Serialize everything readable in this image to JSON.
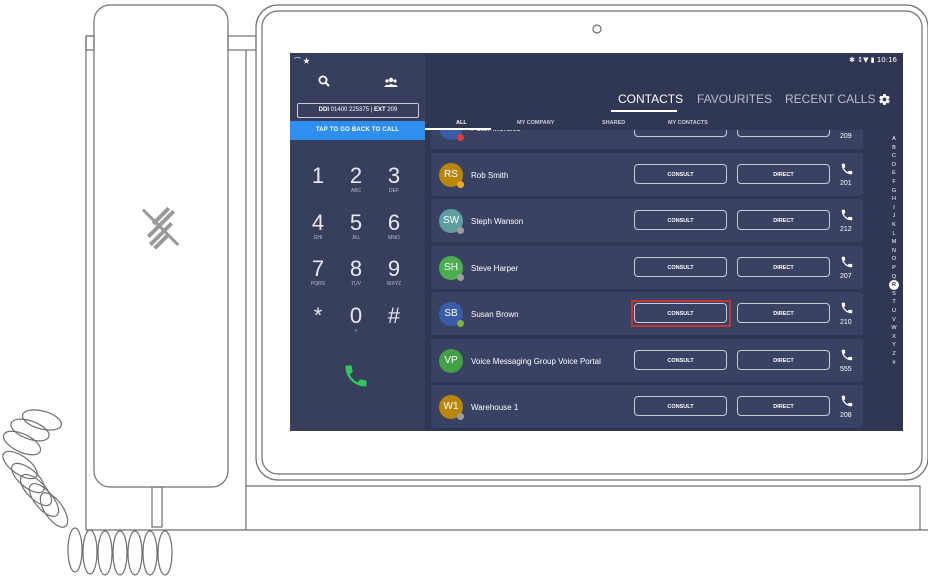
{
  "status_bar": {
    "left_icons": "⌒ ★",
    "right": "✱ ↕▼ ▮ 10:16"
  },
  "left_panel": {
    "search_icon": "search-icon",
    "contacts_icon": "people-icon",
    "ddi_label": "DDI",
    "ddi_number": "01400 225375",
    "separator": "|",
    "ext_label": "EXT",
    "ext_number": "209",
    "tap_back": "TAP TO GO BACK TO CALL",
    "keypad": [
      {
        "digit": "1",
        "letters": ""
      },
      {
        "digit": "2",
        "letters": "ABC"
      },
      {
        "digit": "3",
        "letters": "DEF"
      },
      {
        "digit": "4",
        "letters": "GHI"
      },
      {
        "digit": "5",
        "letters": "JKL"
      },
      {
        "digit": "6",
        "letters": "MNO"
      },
      {
        "digit": "7",
        "letters": "PQRS"
      },
      {
        "digit": "8",
        "letters": "TUV"
      },
      {
        "digit": "9",
        "letters": "WXYZ"
      },
      {
        "digit": "*",
        "letters": ""
      },
      {
        "digit": "0",
        "letters": "+"
      },
      {
        "digit": "#",
        "letters": ""
      }
    ],
    "call_icon": "phone-icon",
    "call_color": "#2dc95b"
  },
  "tabs": [
    "CONTACTS",
    "FAVOURITES",
    "RECENT CALLS"
  ],
  "active_tab": "CONTACTS",
  "settings_icon": "gear-icon",
  "sub_tabs": [
    "ALL",
    "MY COMPANY",
    "SHARED",
    "MY CONTACTS"
  ],
  "active_sub_tab": "ALL",
  "contacts": [
    {
      "initials": "PM",
      "name": "Peter Morales",
      "ext": "209",
      "avatar_color": "#3a5ba8",
      "status_color": "#e53935",
      "consult": "CONSULT",
      "direct": "DIRECT"
    },
    {
      "initials": "RS",
      "name": "Rob Smith",
      "ext": "201",
      "avatar_color": "#b8860b",
      "status_color": "#f5a623",
      "consult": "CONSULT",
      "direct": "DIRECT"
    },
    {
      "initials": "SW",
      "name": "Steph Wanson",
      "ext": "212",
      "avatar_color": "#5f9ea0",
      "status_color": "#9e9e9e",
      "consult": "CONSULT",
      "direct": "DIRECT"
    },
    {
      "initials": "SH",
      "name": "Steve Harper",
      "ext": "207",
      "avatar_color": "#4caf50",
      "status_color": "#9e9e9e",
      "consult": "CONSULT",
      "direct": "DIRECT"
    },
    {
      "initials": "SB",
      "name": "Susan Brown",
      "ext": "210",
      "avatar_color": "#3a5ba8",
      "status_color": "#7cb342",
      "consult": "CONSULT",
      "direct": "DIRECT"
    },
    {
      "initials": "VP",
      "name": "Voice Messaging Group Voice Portal",
      "ext": "555",
      "avatar_color": "#43a047",
      "status_color": "",
      "consult": "CONSULT",
      "direct": "DIRECT"
    },
    {
      "initials": "W1",
      "name": "Warehouse 1",
      "ext": "208",
      "avatar_color": "#b8860b",
      "status_color": "#9e9e9e",
      "consult": "CONSULT",
      "direct": "DIRECT"
    }
  ],
  "alphabet": [
    "A",
    "B",
    "C",
    "D",
    "E",
    "F",
    "G",
    "H",
    "I",
    "J",
    "K",
    "L",
    "M",
    "N",
    "O",
    "P",
    "Q",
    "R",
    "S",
    "T",
    "U",
    "V",
    "W",
    "X",
    "Y",
    "Z",
    "#"
  ],
  "active_letter": "R",
  "highlight_color": "#c53434"
}
